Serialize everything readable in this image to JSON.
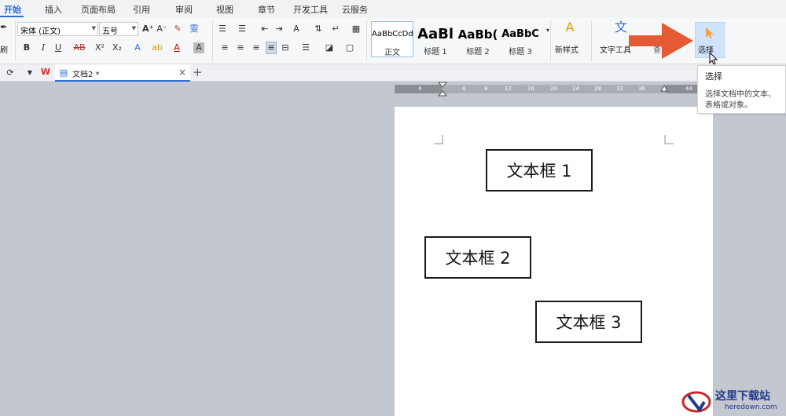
{
  "tabs": [
    "开始",
    "插入",
    "页面布局",
    "引用",
    "审阅",
    "视图",
    "章节",
    "开发工具",
    "云服务"
  ],
  "active_tab": "开始",
  "ribbon": {
    "font_name": "宋体 (正文)",
    "font_size": "五号",
    "styles": [
      {
        "sample": "AaBbCcDd",
        "name": "正文"
      },
      {
        "sample": "AaBl",
        "name": "标题 1"
      },
      {
        "sample": "AaBb(",
        "name": "标题 2"
      },
      {
        "sample": "AaBbC",
        "name": "标题 3"
      }
    ],
    "new_style_label": "新样式",
    "text_tools_label": "文字工具",
    "find_label": "查找",
    "select_label": "选择",
    "left_cut_label1": "",
    "left_cut_label2": "刷"
  },
  "document_tab": {
    "title": "文档2 *",
    "close": "×",
    "new": "+"
  },
  "ruler_ticks": [
    "4",
    "4",
    "8",
    "12",
    "16",
    "20",
    "24",
    "28",
    "32",
    "36",
    "44"
  ],
  "page": {
    "textboxes": [
      "文本框 1",
      "文本框 2",
      "文本框 3"
    ]
  },
  "tooltip": {
    "title": "选择",
    "description": "选择文档中的文本、表格或对象。"
  },
  "watermark": {
    "text": "这里下载站",
    "url": "heredown.com"
  },
  "colors": {
    "accent": "#2b6fd3",
    "arrow": "#e45a35",
    "select_highlight": "#cfe3fb"
  }
}
